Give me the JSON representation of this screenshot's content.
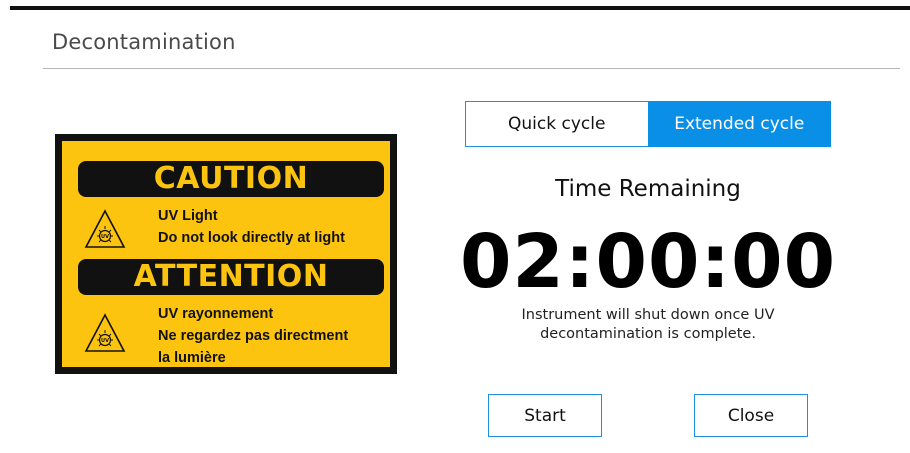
{
  "dialog": {
    "title": "Decontamination"
  },
  "caution_sign": {
    "banner_1": "CAUTION",
    "text_1": [
      "UV Light",
      "Do not look directly at light"
    ],
    "banner_2": "ATTENTION",
    "text_2": [
      "UV rayonnement",
      "Ne regardez pas directment",
      "la lumière"
    ],
    "icon_symbol": "UV",
    "colors": {
      "background": "#fdc40f",
      "frame": "#111111"
    }
  },
  "cycle_selector": {
    "options": [
      "Quick cycle",
      "Extended cycle"
    ],
    "selected": "Extended cycle",
    "accent_color": "#0a8fe6"
  },
  "timer": {
    "label": "Time Remaining",
    "value": "02:00:00",
    "note_lines": [
      "Instrument will shut down once UV",
      "decontamination is complete."
    ]
  },
  "actions": {
    "start_label": "Start",
    "close_label": "Close"
  }
}
